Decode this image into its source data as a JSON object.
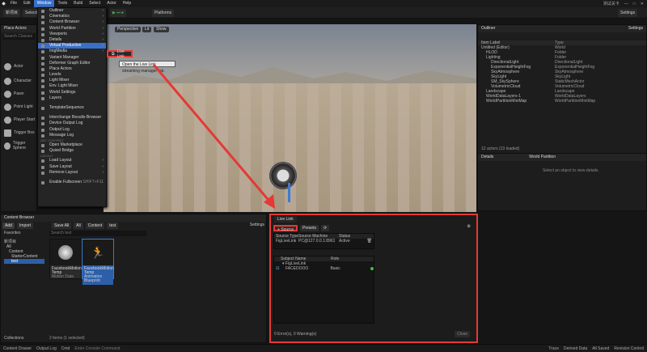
{
  "menubar": {
    "items": [
      "File",
      "Edit",
      "Window",
      "Tools",
      "Build",
      "Select",
      "Actor",
      "Help"
    ],
    "active": "Window",
    "project": "新项目",
    "right": [
      "测试关卡",
      "—",
      "□",
      "✕"
    ]
  },
  "toolbar": {
    "mode": "Selection Mode",
    "platforms": "Platforms",
    "settings": "Settings"
  },
  "place_actors": {
    "title": "Place Actors",
    "search": "Search Classes",
    "items": [
      "Actor",
      "Character",
      "Pawn",
      "Point Light",
      "Player Start",
      "Trigger Box",
      "Trigger Sphere"
    ]
  },
  "window_menu": {
    "sections": [
      {
        "label": "",
        "rows": [
          {
            "t": "Outliner",
            "sub": true
          },
          {
            "t": "Cinematics",
            "sub": true
          },
          {
            "t": "Content Browser",
            "sub": true
          },
          {
            "t": "World Partition",
            "sub": true
          },
          {
            "t": "Viewports",
            "sub": true
          },
          {
            "t": "Details",
            "sub": true
          },
          {
            "t": "Virtual Production",
            "sub": true,
            "hl": true
          },
          {
            "t": "ImgMedia",
            "sub": true
          },
          {
            "t": "Variant Manager"
          },
          {
            "t": "Deformer Graph Editor"
          },
          {
            "t": "Place Actors"
          },
          {
            "t": "Levels"
          },
          {
            "t": "Light Mixer"
          },
          {
            "t": "Env. Light Mixer"
          },
          {
            "t": "World Settings"
          },
          {
            "t": "Layers"
          }
        ]
      },
      {
        "label": "",
        "rows": [
          {
            "t": "TemplateSequence"
          }
        ]
      },
      {
        "label": "",
        "rows": [
          {
            "t": "Interchange Results Browser"
          },
          {
            "t": "Device Output Log"
          },
          {
            "t": "Output Log"
          },
          {
            "t": "Message Log"
          }
        ]
      },
      {
        "label": "GET CONTENT",
        "rows": [
          {
            "t": "Open Marketplace"
          },
          {
            "t": "Quixel Bridge"
          }
        ]
      },
      {
        "label": "LAYOUT",
        "rows": [
          {
            "t": "Load Layout",
            "sub": true
          },
          {
            "t": "Save Layout",
            "sub": true
          },
          {
            "t": "Remove Layout",
            "sub": true
          }
        ]
      },
      {
        "label": "",
        "rows": [
          {
            "t": "Enable Fullscreen",
            "shortcut": "SHIFT+F11"
          }
        ]
      }
    ]
  },
  "submenu": {
    "label": "Live Link"
  },
  "tooltip": "Open the Live Link streaming manager tab.",
  "viewport": {
    "perspective": "Perspective",
    "lit": "Lit",
    "show": "Show"
  },
  "outliner": {
    "title": "Outliner",
    "settings": "Settings",
    "cols": [
      "Item Label",
      "Type"
    ],
    "rows": [
      [
        "Untitled (Editor)",
        "World"
      ],
      [
        "HLOD",
        "Folder"
      ],
      [
        "Lighting",
        "Folder"
      ],
      [
        "DirectionalLight",
        "DirectionalLight"
      ],
      [
        "ExponentialHeightFog",
        "ExponentialHeightFog"
      ],
      [
        "SkyAtmosphere",
        "SkyAtmosphere"
      ],
      [
        "SkyLight",
        "SkyLight"
      ],
      [
        "SM_SkySphere",
        "StaticMeshActor"
      ],
      [
        "VolumetricCloud",
        "VolumetricCloud"
      ],
      [
        "Landscape",
        "Landscape"
      ],
      [
        "WorldDataLayers-1",
        "WorldDataLayers"
      ],
      [
        "WorldPartitionMiniMap",
        "WorldPartitionMiniMap"
      ]
    ],
    "count": "12 actors (13 loaded)"
  },
  "details": {
    "title": "Details",
    "tab2": "World Partition",
    "empty": "Select an object to view details."
  },
  "content_browser": {
    "title": "Content Browser",
    "add": "Add",
    "import": "Import",
    "save_all": "Save All",
    "path": [
      "All",
      "Content",
      "test"
    ],
    "settings": "Settings",
    "search": "Search test",
    "favorites": "Favorites",
    "project": "新项目",
    "tree": [
      "All",
      "Content",
      "StarterContent",
      "test"
    ],
    "assets": [
      {
        "name": "FacebookMotion Temp",
        "type": "Motion Data"
      },
      {
        "name": "FacebookMotion Temp",
        "type": "Animation Blueprint"
      }
    ],
    "status": "2 items (1 selected)",
    "collections": "Collections"
  },
  "livelink": {
    "tab": "Live Link",
    "source": "Source",
    "presets": "Presets",
    "src_cols": [
      "Source Type",
      "Source Machine",
      "Status"
    ],
    "src_row": [
      "FigLiveLink",
      "PC@127.0.0.1:8961",
      "Active"
    ],
    "subj_cols": [
      "Subject Name",
      "Role"
    ],
    "subj_rows": [
      [
        "FigLiveLink",
        ""
      ],
      [
        "FACEDOOO",
        "Basic"
      ]
    ],
    "errors": "0 Error(s), 0 Warning(s)",
    "close": "Close"
  },
  "statusbar": {
    "items": [
      "Content Drawer",
      "Output Log",
      "Cmd",
      "Enter Console Command"
    ],
    "right": [
      "Trace",
      "Derived Data",
      "All Saved",
      "Revision Control"
    ]
  },
  "colors": {
    "accent": "#3a6fc7",
    "highlight": "#e53935",
    "status_green": "#3fbf3f"
  }
}
